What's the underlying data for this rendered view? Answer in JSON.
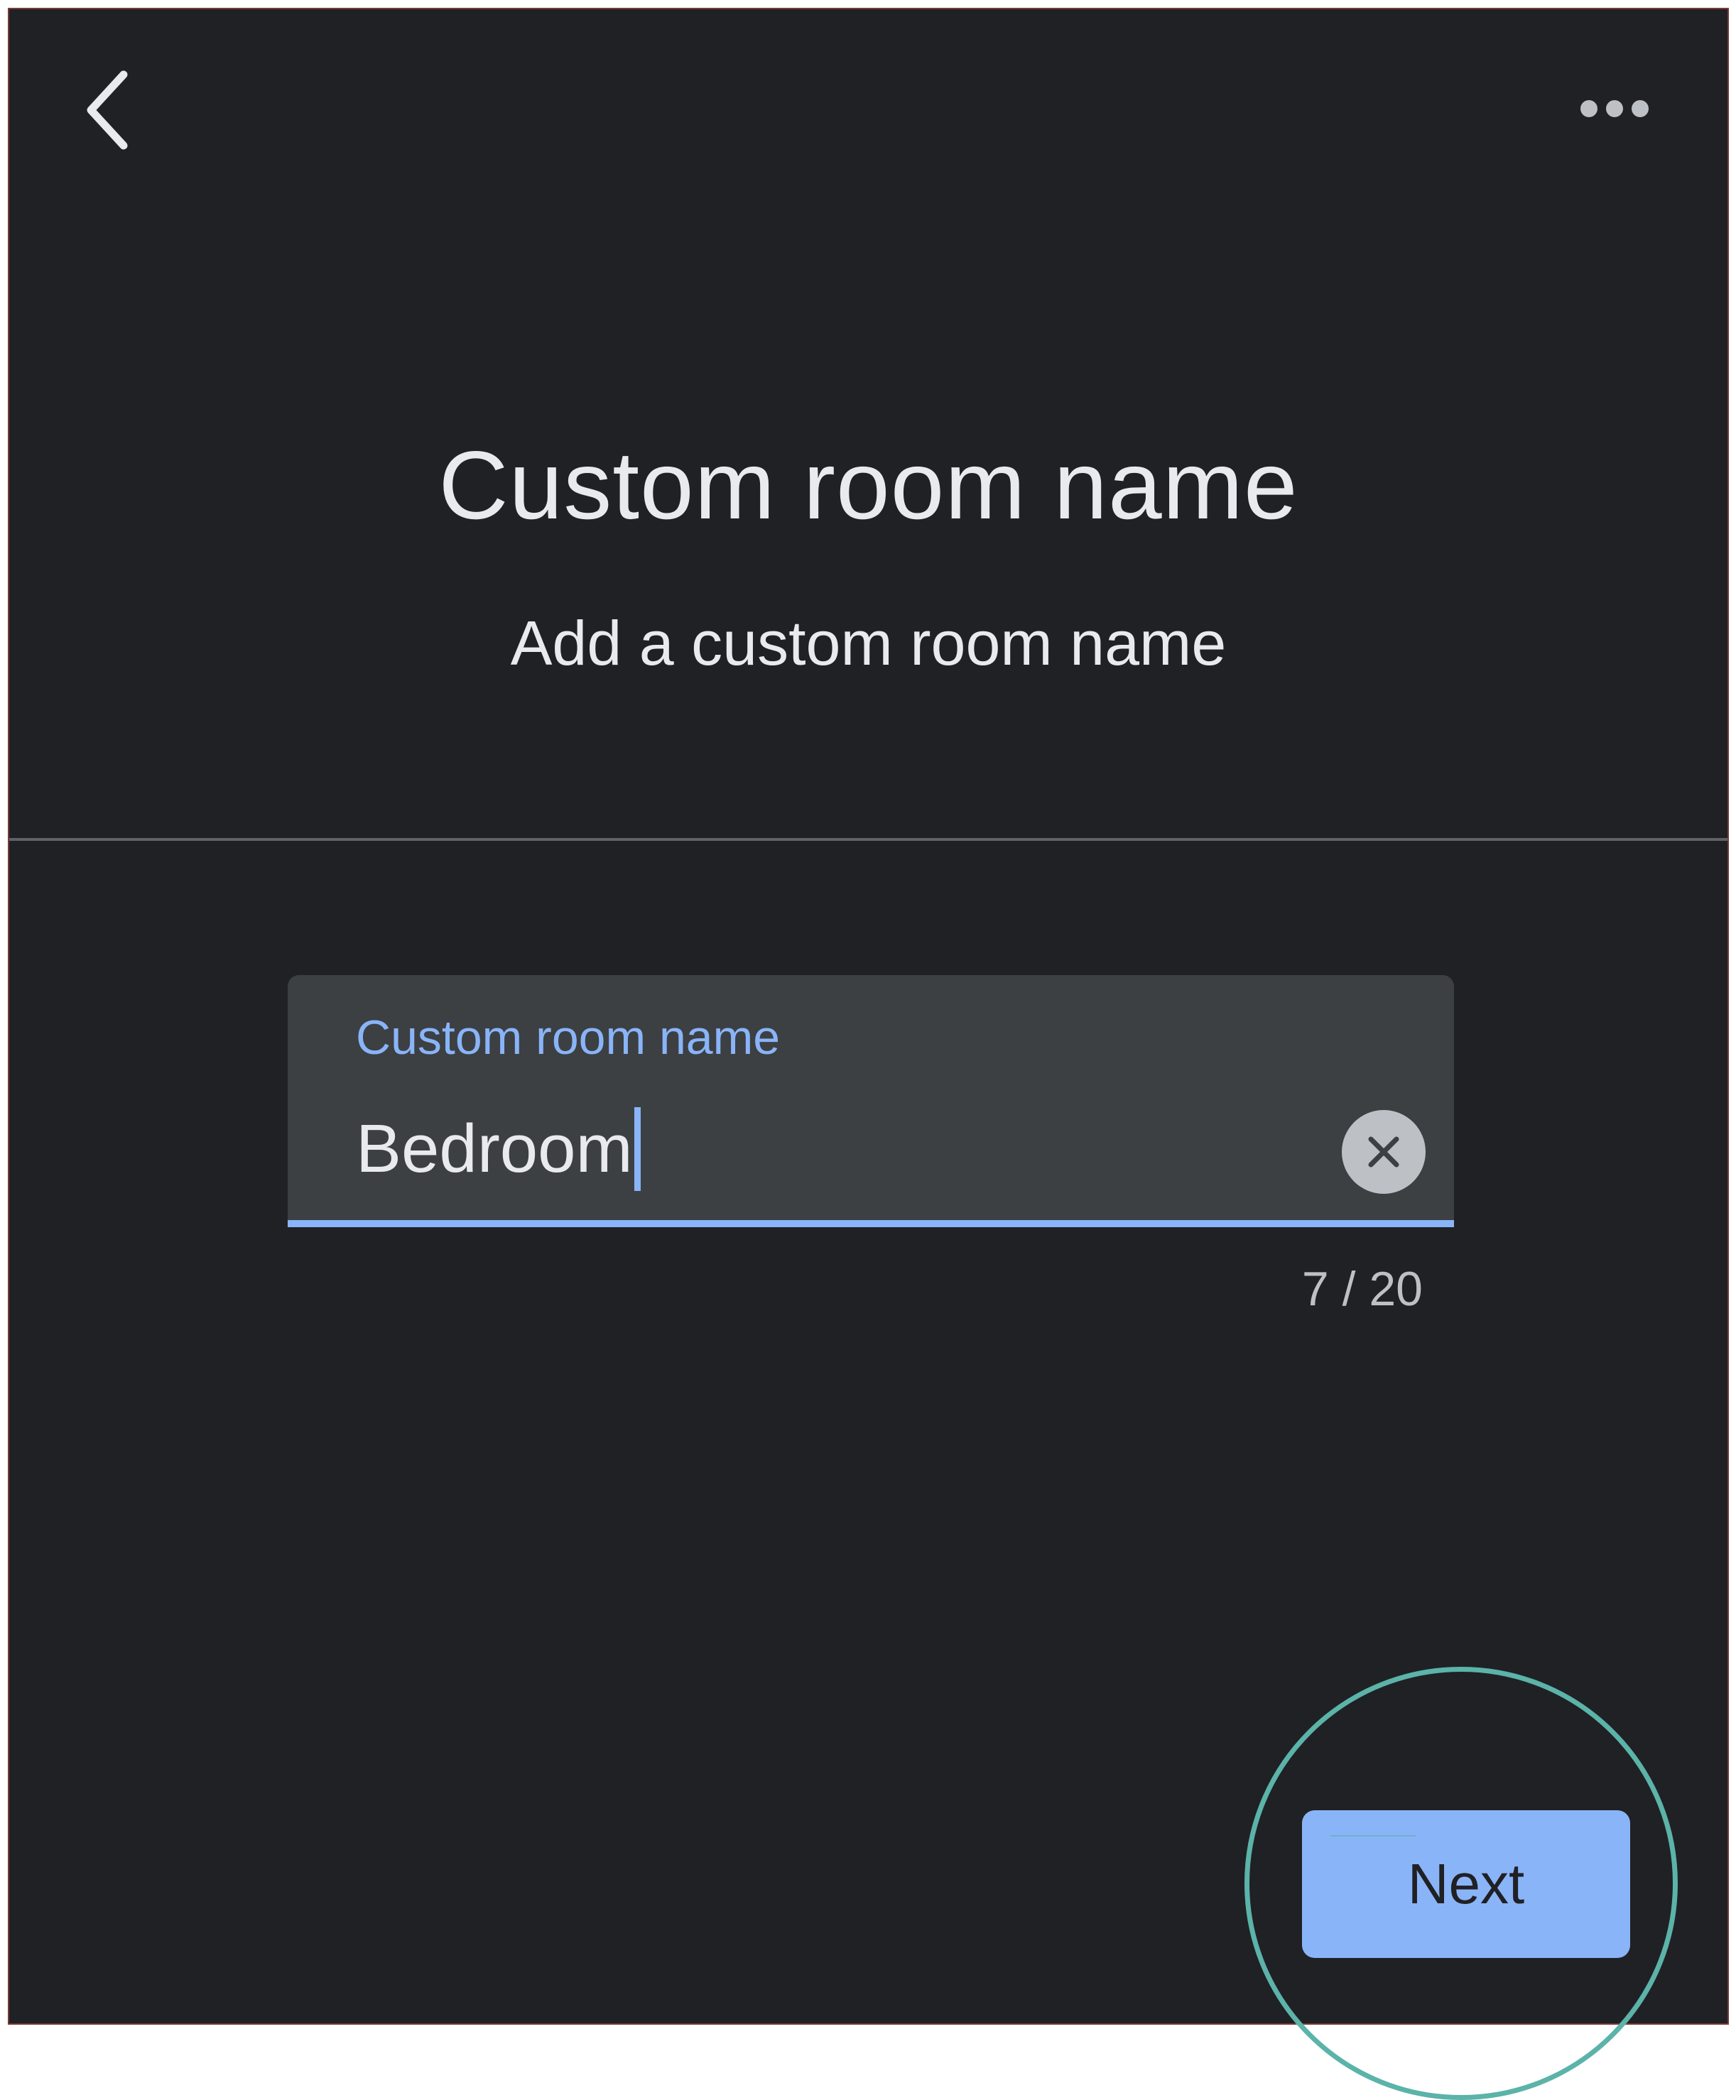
{
  "header": {
    "back_icon": "chevron-left-icon",
    "more_icon": "more-horiz-icon"
  },
  "main": {
    "title": "Custom room name",
    "subtitle": "Add a custom room name"
  },
  "field": {
    "label": "Custom room name",
    "value": "Bedroom",
    "counter": "7 / 20",
    "clear_icon": "close-icon",
    "accent_color": "#8ab4f8"
  },
  "footer": {
    "next_label": "Next"
  },
  "theme": {
    "background": "#202124",
    "text": "#e8eaed",
    "field_background": "#3c4043",
    "highlight_ring": "#5bb3a9"
  }
}
